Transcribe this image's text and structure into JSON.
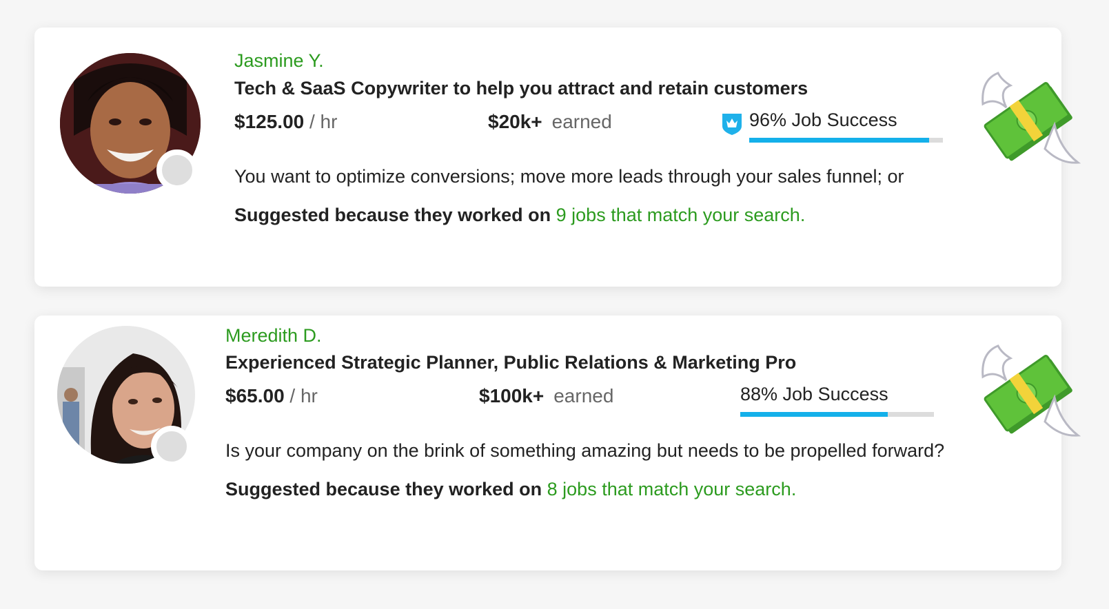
{
  "colors": {
    "accent_green": "#2c9b1f",
    "progress_blue": "#14b0ea",
    "badge_blue": "#1fb1ea",
    "money_green": "#5fc23a"
  },
  "freelancers": [
    {
      "name": "Jasmine Y.",
      "title": "Tech & SaaS Copywriter to help you attract and retain customers",
      "rate": "$125.00",
      "rate_unit": "/ hr",
      "earned_amount": "$20k+",
      "earned_label": "earned",
      "has_top_rated_badge": true,
      "badge_icon": "top-rated-shield-icon",
      "job_success_label": "96% Job Success",
      "job_success_fraction": 0.93,
      "description": "You want to optimize conversions; move more leads through your sales funnel; or",
      "suggested_lead": "Suggested because they worked on",
      "suggested_link": "9 jobs that match your search.",
      "decoration_icon": "flying-money-icon"
    },
    {
      "name": "Meredith D.",
      "title": "Experienced Strategic Planner, Public Relations & Marketing Pro",
      "rate": "$65.00",
      "rate_unit": "/ hr",
      "earned_amount": "$100k+",
      "earned_label": "earned",
      "has_top_rated_badge": false,
      "job_success_label": "88% Job Success",
      "job_success_fraction": 0.76,
      "description": "Is your company on the brink of something amazing but needs to be propelled forward?",
      "suggested_lead": "Suggested because they worked on",
      "suggested_link": "8 jobs that match your search.",
      "decoration_icon": "flying-money-icon"
    }
  ]
}
